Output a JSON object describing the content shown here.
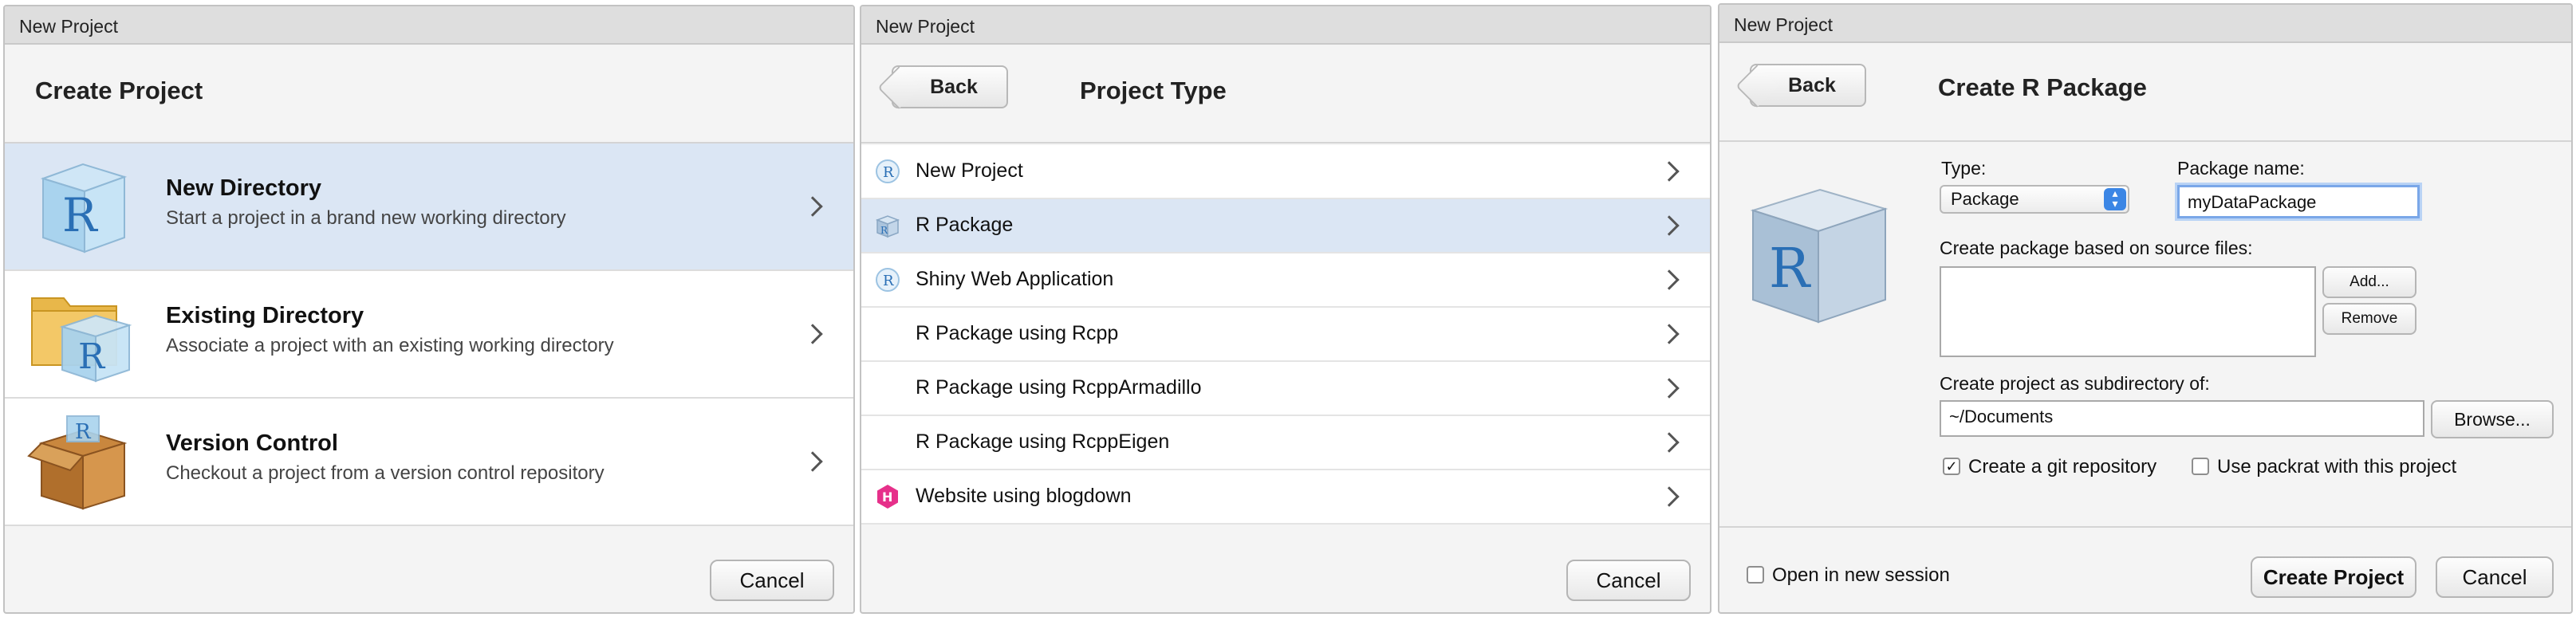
{
  "dialog1": {
    "window_title": "New Project",
    "header_title": "Create Project",
    "items": [
      {
        "title": "New Directory",
        "subtitle": "Start a project in a brand new working directory",
        "icon": "r-cube-icon"
      },
      {
        "title": "Existing Directory",
        "subtitle": "Associate a project with an existing working directory",
        "icon": "folder-r-icon"
      },
      {
        "title": "Version Control",
        "subtitle": "Checkout a project from a version control repository",
        "icon": "box-icon"
      }
    ],
    "cancel_label": "Cancel"
  },
  "dialog2": {
    "window_title": "New Project",
    "back_label": "Back",
    "header_title": "Project Type",
    "items": [
      {
        "label": "New Project",
        "icon": "r-circle-icon"
      },
      {
        "label": "R Package",
        "icon": "r-package-icon"
      },
      {
        "label": "Shiny Web Application",
        "icon": "r-circle-icon"
      },
      {
        "label": "R Package using Rcpp",
        "icon": ""
      },
      {
        "label": "R Package using RcppArmadillo",
        "icon": ""
      },
      {
        "label": "R Package using RcppEigen",
        "icon": ""
      },
      {
        "label": "Website using blogdown",
        "icon": "hugo-icon"
      }
    ],
    "cancel_label": "Cancel"
  },
  "dialog3": {
    "window_title": "New Project",
    "back_label": "Back",
    "header_title": "Create R Package",
    "type_label": "Type:",
    "type_value": "Package",
    "package_name_label": "Package name:",
    "package_name_value": "myDataPackage",
    "source_files_label": "Create package based on source files:",
    "add_label": "Add...",
    "remove_label": "Remove",
    "subdir_label": "Create project as subdirectory of:",
    "subdir_value": "~/Documents",
    "browse_label": "Browse...",
    "git_label": "Create a git repository",
    "git_checked": true,
    "packrat_label": "Use packrat with this project",
    "packrat_checked": false,
    "open_session_label": "Open in new session",
    "open_session_checked": false,
    "create_label": "Create Project",
    "cancel_label": "Cancel"
  },
  "colors": {
    "selection": "#dbe6f4",
    "focus": "#7aa7e8",
    "select_arrow": "#3b86e5",
    "hugo": "#e6308a"
  }
}
